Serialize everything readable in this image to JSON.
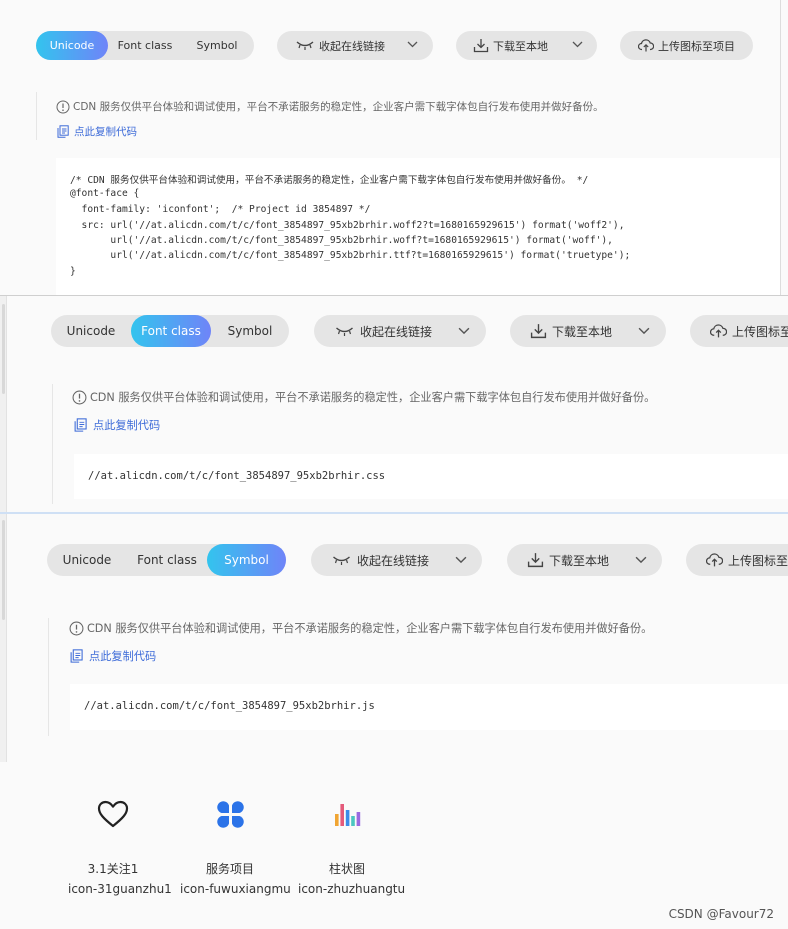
{
  "panels": [
    {
      "tabs": [
        "Unicode",
        "Font class",
        "Symbol"
      ],
      "active_tab": "Unicode",
      "collapse_label": "收起在线链接",
      "download_label": "下载至本地",
      "upload_label": "上传图标至项目",
      "notice": "CDN 服务仅供平台体验和调试使用，平台不承诺服务的稳定性，企业客户需下载字体包自行发布使用并做好备份。",
      "copy_label": "点此复制代码",
      "code_lines": [
        "/* CDN 服务仅供平台体验和调试使用，平台不承诺服务的稳定性，企业客户需下载字体包自行发布使用并做好备份。 */",
        "@font-face {",
        "  font-family: 'iconfont';  /* Project id 3854897 */",
        "  src: url('//at.alicdn.com/t/c/font_3854897_95xb2brhir.woff2?t=1680165929615') format('woff2'),",
        "       url('//at.alicdn.com/t/c/font_3854897_95xb2brhir.woff?t=1680165929615') format('woff'),",
        "       url('//at.alicdn.com/t/c/font_3854897_95xb2brhir.ttf?t=1680165929615') format('truetype');",
        "}"
      ]
    },
    {
      "tabs": [
        "Unicode",
        "Font class",
        "Symbol"
      ],
      "active_tab": "Font class",
      "collapse_label": "收起在线链接",
      "download_label": "下载至本地",
      "upload_label": "上传图标至",
      "notice": "CDN 服务仅供平台体验和调试使用，平台不承诺服务的稳定性，企业客户需下载字体包自行发布使用并做好备份。",
      "copy_label": "点此复制代码",
      "code_lines": [
        "//at.alicdn.com/t/c/font_3854897_95xb2brhir.css"
      ]
    },
    {
      "tabs": [
        "Unicode",
        "Font class",
        "Symbol"
      ],
      "active_tab": "Symbol",
      "collapse_label": "收起在线链接",
      "download_label": "下载至本地",
      "upload_label": "上传图标至",
      "notice": "CDN 服务仅供平台体验和调试使用，平台不承诺服务的稳定性，企业客户需下载字体包自行发布使用并做好备份。",
      "copy_label": "点此复制代码",
      "code_lines": [
        "//at.alicdn.com/t/c/font_3854897_95xb2brhir.js"
      ]
    }
  ],
  "icons": [
    {
      "name": "3.1关注1",
      "code": "icon-31guanzhu1",
      "icon": "heart-outline-icon",
      "color": "#222222"
    },
    {
      "name": "服务项目",
      "code": "icon-fuwuxiangmu",
      "icon": "four-petal-clover-icon",
      "color": "#2b73e8"
    },
    {
      "name": "柱状图",
      "code": "icon-zhuzhuangtu",
      "icon": "bar-chart-icon",
      "colors": [
        "#f0a533",
        "#e45a7a",
        "#3c8ce8",
        "#4cc6c0",
        "#9a6ae0"
      ]
    }
  ],
  "watermark": "CSDN @Favour72",
  "colors": {
    "accent_start": "#33c4ee",
    "accent_end": "#6f84f8",
    "link": "#3d6bd8"
  }
}
